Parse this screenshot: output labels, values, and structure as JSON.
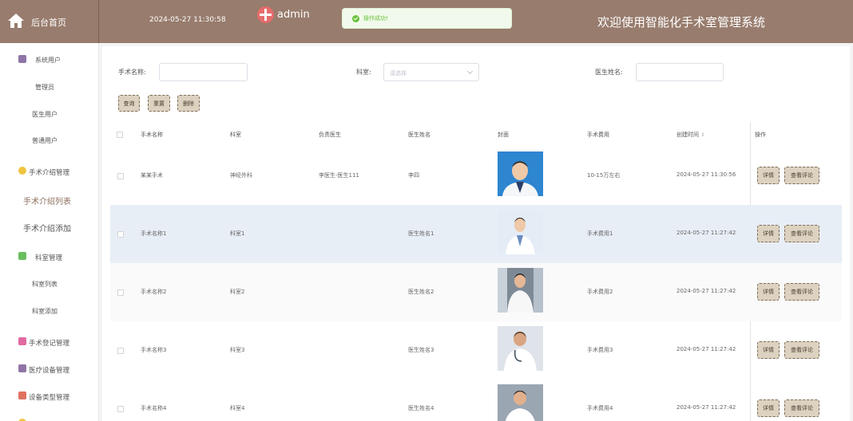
{
  "header": {
    "home_label": "后台首页",
    "datetime": "2024-05-27 11:30:58",
    "username": "admin",
    "toast": "操作成功!",
    "system_title": "欢迎使用智能化手术室管理系统"
  },
  "sidebar": {
    "items": [
      {
        "label": "系统用户",
        "icon": "user-group-icon",
        "color": "#8f75a6"
      },
      {
        "label": "管理员"
      },
      {
        "label": "医生用户"
      },
      {
        "label": "普通用户"
      },
      {
        "label": "手术介绍管理",
        "icon": "circle-icon",
        "color": "#f0c541"
      },
      {
        "label": "手术介绍列表",
        "active": true
      },
      {
        "label": "手术介绍添加"
      },
      {
        "label": "科室管理",
        "icon": "chat-icon",
        "color": "#6abf5e"
      },
      {
        "label": "科室列表"
      },
      {
        "label": "科室添加"
      },
      {
        "label": "手术登记管理",
        "icon": "document-icon",
        "color": "#e06aa0"
      },
      {
        "label": "医疗设备管理",
        "icon": "box-icon",
        "color": "#8f75a6"
      },
      {
        "label": "设备类型管理",
        "icon": "grid-icon",
        "color": "#e07060"
      }
    ]
  },
  "filters": {
    "name_label": "手术名称:",
    "dept_label": "科室:",
    "dept_placeholder": "请选择",
    "doctor_label": "医生姓名:",
    "query_btn": "查询",
    "reset_btn": "重置",
    "delete_btn": "删除"
  },
  "table": {
    "columns": [
      "手术名称",
      "科室",
      "负责医生",
      "医生姓名",
      "封面",
      "手术费用",
      "创建时间",
      "操作"
    ],
    "rows": [
      {
        "name": "某某手术",
        "dept": "神经外科",
        "lead": "李医生-医生111",
        "doctor": "李四",
        "fee": "10-15万左右",
        "created": "2024-05-27 11:30:56"
      },
      {
        "name": "手术名称1",
        "dept": "科室1",
        "lead": "",
        "doctor": "医生姓名1",
        "fee": "手术费用1",
        "created": "2024-05-27 11:27:42"
      },
      {
        "name": "手术名称2",
        "dept": "科室2",
        "lead": "",
        "doctor": "医生姓名2",
        "fee": "手术费用2",
        "created": "2024-05-27 11:27:42"
      },
      {
        "name": "手术名称3",
        "dept": "科室3",
        "lead": "",
        "doctor": "医生姓名3",
        "fee": "手术费用3",
        "created": "2024-05-27 11:27:42"
      },
      {
        "name": "手术名称4",
        "dept": "科室4",
        "lead": "",
        "doctor": "医生姓名4",
        "fee": "手术费用4",
        "created": "2024-05-27 11:27:42"
      }
    ],
    "detail_btn": "详情",
    "reviews_btn": "查看评论"
  },
  "colors": {
    "header_bg": "#987c6d",
    "button_bg": "#ddd2c0",
    "success": "#67c23a",
    "row_hover": "#e8eef6"
  }
}
